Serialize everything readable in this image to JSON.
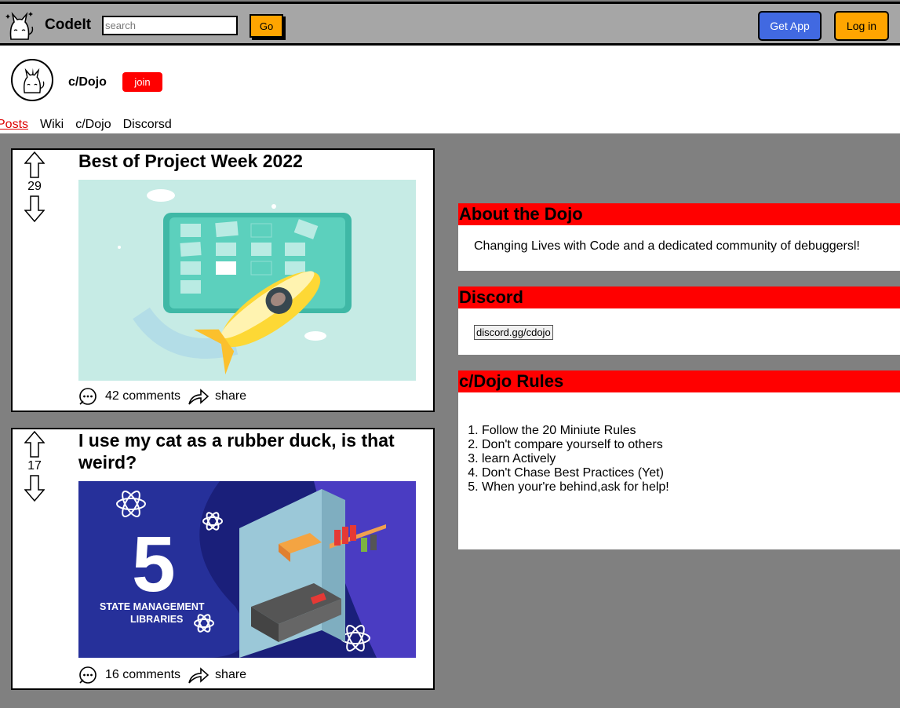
{
  "header": {
    "brand": "CodeIt",
    "search_placeholder": "search",
    "go_label": "Go",
    "get_app_label": "Get App",
    "login_label": "Log in"
  },
  "community": {
    "name": "c/Dojo",
    "join_label": "join",
    "tabs": [
      "Posts",
      "Wiki",
      "c/Dojo",
      "Discorsd"
    ]
  },
  "posts": [
    {
      "title": "Best of Project Week 2022",
      "votes": "29",
      "comments": "42 comments",
      "share": "share"
    },
    {
      "title": "I use my cat as a rubber duck, is that weird?",
      "votes": "17",
      "comments": "16 comments",
      "share": "share",
      "image_text": {
        "number": "5",
        "line1": "STATE MANAGEMENT",
        "line2": "LIBRARIES"
      }
    }
  ],
  "sidebar": {
    "about": {
      "title": "About the Dojo",
      "text": "Changing Lives with Code and a dedicated community of debuggersl!"
    },
    "discord": {
      "title": "Discord",
      "link": "discord.gg/cdojo"
    },
    "rules": {
      "title": "c/Dojo Rules",
      "items": [
        "Follow the 20 Miniute Rules",
        "Don't compare yourself to others",
        "learn Actively",
        "Don't Chase Best Practices (Yet)",
        "When your're behind,ask for help!"
      ]
    }
  },
  "colors": {
    "background": "#808080",
    "header": "#a6a6a6",
    "accent_red": "#ff0000",
    "accent_orange": "#ffa500",
    "accent_blue": "#4169e1"
  }
}
